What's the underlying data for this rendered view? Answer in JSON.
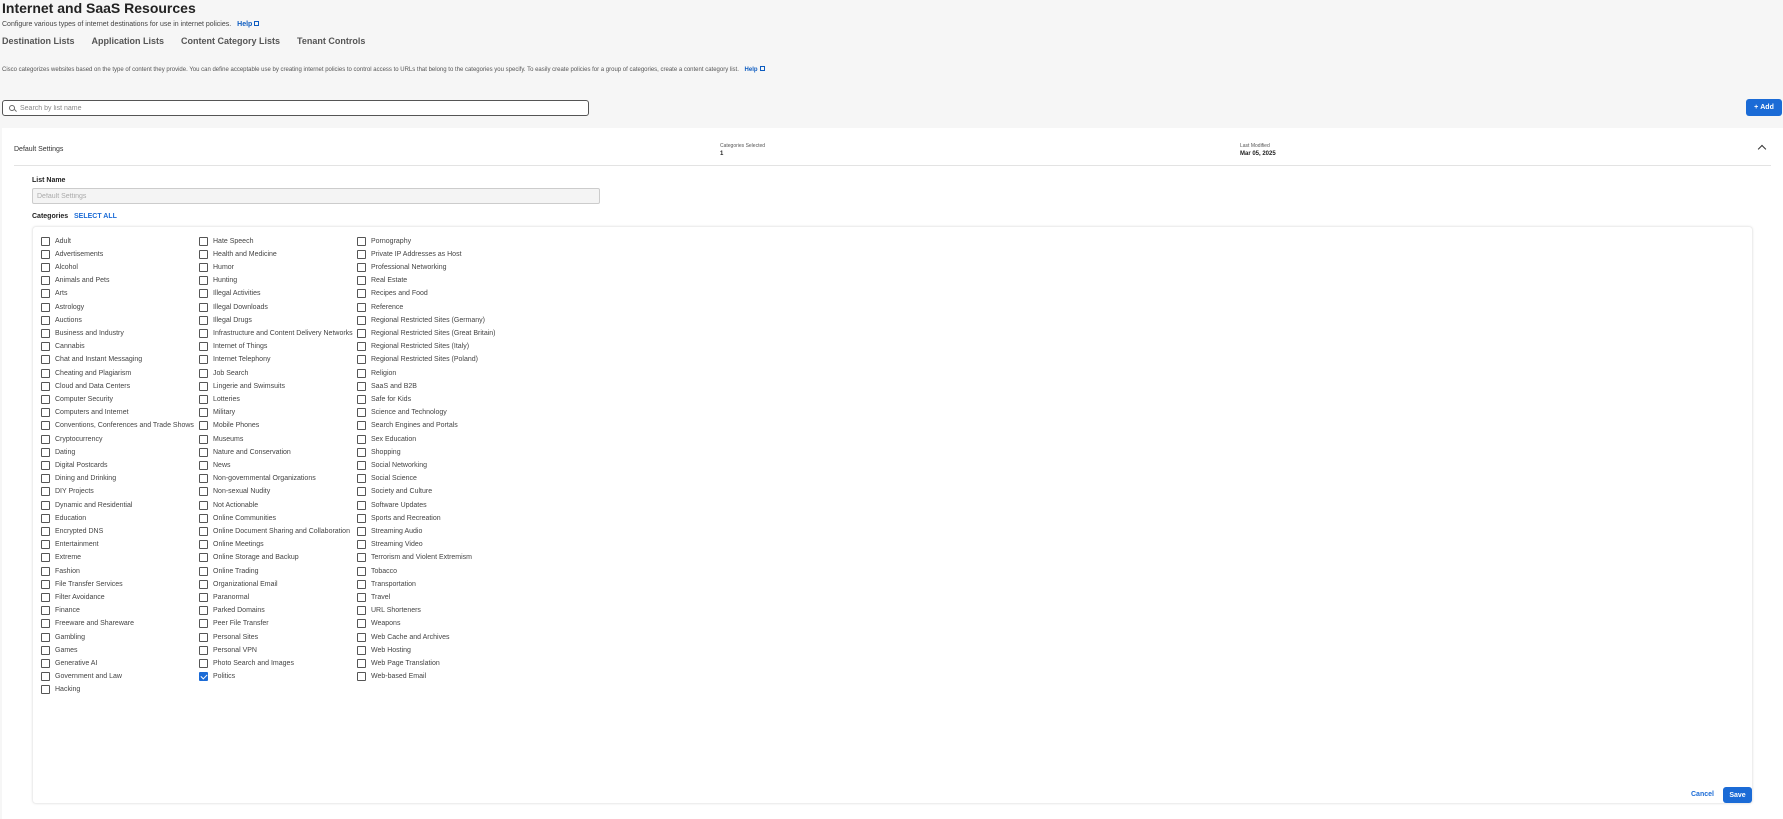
{
  "page": {
    "title": "Internet and SaaS Resources",
    "subtitle": "Configure various types of internet destinations for use in internet policies.",
    "help_label": "Help",
    "tabs": [
      "Destination Lists",
      "Application Lists",
      "Content Category Lists",
      "Tenant Controls"
    ],
    "description": "Cisco categorizes websites based on the type of content they provide. You can define acceptable use by creating internet policies to control access to URLs that belong to the categories you specify. To easily create policies for a group of categories, create a content category list.",
    "desc_help_label": "Help"
  },
  "search": {
    "placeholder": "Search by list name"
  },
  "add_button": {
    "icon": "+",
    "label": "Add"
  },
  "list_row": {
    "name": "Default Settings",
    "categories_selected_label": "Categories Selected",
    "categories_selected_value": "1",
    "last_modified_label": "Last Modified",
    "last_modified_value": "Mar 05, 2025"
  },
  "form": {
    "list_name_label": "List Name",
    "list_name_placeholder": "Default Settings",
    "categories_label": "Categories",
    "select_all_label": "SELECT ALL"
  },
  "categories": {
    "columns": [
      [
        "Adult",
        "Advertisements",
        "Alcohol",
        "Animals and Pets",
        "Arts",
        "Astrology",
        "Auctions",
        "Business and Industry",
        "Cannabis",
        "Chat and Instant Messaging",
        "Cheating and Plagiarism",
        "Cloud and Data Centers",
        "Computer Security",
        "Computers and Internet",
        "Conventions, Conferences and Trade Shows",
        "Cryptocurrency",
        "Dating",
        "Digital Postcards",
        "Dining and Drinking",
        "DIY Projects",
        "Dynamic and Residential",
        "Education",
        "Encrypted DNS",
        "Entertainment",
        "Extreme",
        "Fashion",
        "File Transfer Services",
        "Filter Avoidance",
        "Finance",
        "Freeware and Shareware",
        "Gambling",
        "Games",
        "Generative AI",
        "Government and Law",
        "Hacking"
      ],
      [
        "Hate Speech",
        "Health and Medicine",
        "Humor",
        "Hunting",
        "Illegal Activities",
        "Illegal Downloads",
        "Illegal Drugs",
        "Infrastructure and Content Delivery Networks",
        "Internet of Things",
        "Internet Telephony",
        "Job Search",
        "Lingerie and Swimsuits",
        "Lotteries",
        "Military",
        "Mobile Phones",
        "Museums",
        "Nature and Conservation",
        "News",
        "Non-governmental Organizations",
        "Non-sexual Nudity",
        "Not Actionable",
        "Online Communities",
        "Online Document Sharing and Collaboration",
        "Online Meetings",
        "Online Storage and Backup",
        "Online Trading",
        "Organizational Email",
        "Paranormal",
        "Parked Domains",
        "Peer File Transfer",
        "Personal Sites",
        "Personal VPN",
        "Photo Search and Images",
        "Politics"
      ],
      [
        "Pornography",
        "Private IP Addresses as Host",
        "Professional Networking",
        "Real Estate",
        "Recipes and Food",
        "Reference",
        "Regional Restricted Sites (Germany)",
        "Regional Restricted Sites (Great Britain)",
        "Regional Restricted Sites (Italy)",
        "Regional Restricted Sites (Poland)",
        "Religion",
        "SaaS and B2B",
        "Safe for Kids",
        "Science and Technology",
        "Search Engines and Portals",
        "Sex Education",
        "Shopping",
        "Social Networking",
        "Social Science",
        "Society and Culture",
        "Software Updates",
        "Sports and Recreation",
        "Streaming Audio",
        "Streaming Video",
        "Terrorism and Violent Extremism",
        "Tobacco",
        "Transportation",
        "Travel",
        "URL Shorteners",
        "Weapons",
        "Web Cache and Archives",
        "Web Hosting",
        "Web Page Translation",
        "Web-based Email"
      ]
    ],
    "checked": [
      "Politics"
    ]
  },
  "footer": {
    "cancel_label": "Cancel",
    "save_label": "Save"
  },
  "colors": {
    "accent": "#1b6bd6",
    "background": "#f6f6f6"
  }
}
